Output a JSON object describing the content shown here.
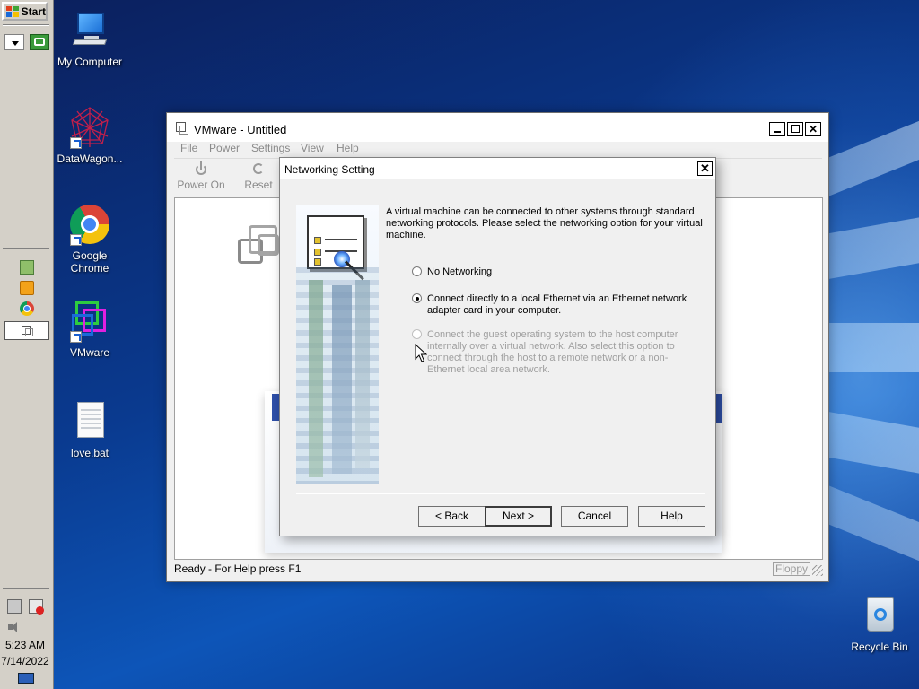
{
  "taskbar": {
    "start_label": "Start",
    "clock_time": "5:23 AM",
    "clock_date": "7/14/2022"
  },
  "desktop": {
    "icons": [
      {
        "label": "My Computer",
        "icon": "computer-icon"
      },
      {
        "label": "DataWagon...",
        "icon": "datawagon-icon"
      },
      {
        "label": "Google Chrome",
        "icon": "chrome-icon"
      },
      {
        "label": "VMware",
        "icon": "vmware-icon"
      },
      {
        "label": "love.bat",
        "icon": "batch-file-icon"
      },
      {
        "label": "Recycle Bin",
        "icon": "recycle-bin-icon"
      }
    ]
  },
  "vmware": {
    "title": "VMware - Untitled",
    "menu": [
      "File",
      "Power",
      "Settings",
      "View",
      "Help"
    ],
    "toolbar": [
      {
        "label": "Power On",
        "icon": "power-icon"
      },
      {
        "label": "Reset",
        "icon": "reset-icon"
      }
    ],
    "status_text": "Ready - For Help press F1",
    "status_floppy": "Floppy"
  },
  "dialog": {
    "title": "Networking Setting",
    "description": "A virtual machine can be connected to other systems through standard networking protocols. Please select the networking option for your virtual machine.",
    "options": [
      {
        "label": "No Networking",
        "checked": false,
        "enabled": true
      },
      {
        "label": "Connect directly to a local Ethernet via an Ethernet network adapter card in your computer.",
        "checked": true,
        "enabled": true
      },
      {
        "label": "Connect the guest operating system to the host computer internally over a virtual network. Also select this option to connect through the host to a remote network or a non-Ethernet local area network.",
        "checked": false,
        "enabled": false
      }
    ],
    "buttons": {
      "back": "< Back",
      "next": "Next >",
      "cancel": "Cancel",
      "help": "Help"
    }
  },
  "colors": {
    "desktop_blue": "#0a3a8f",
    "dialog_bg": "#f0f0f0",
    "taskbar_gray": "#d4d0c8",
    "disabled_text": "#a0a0a0"
  }
}
